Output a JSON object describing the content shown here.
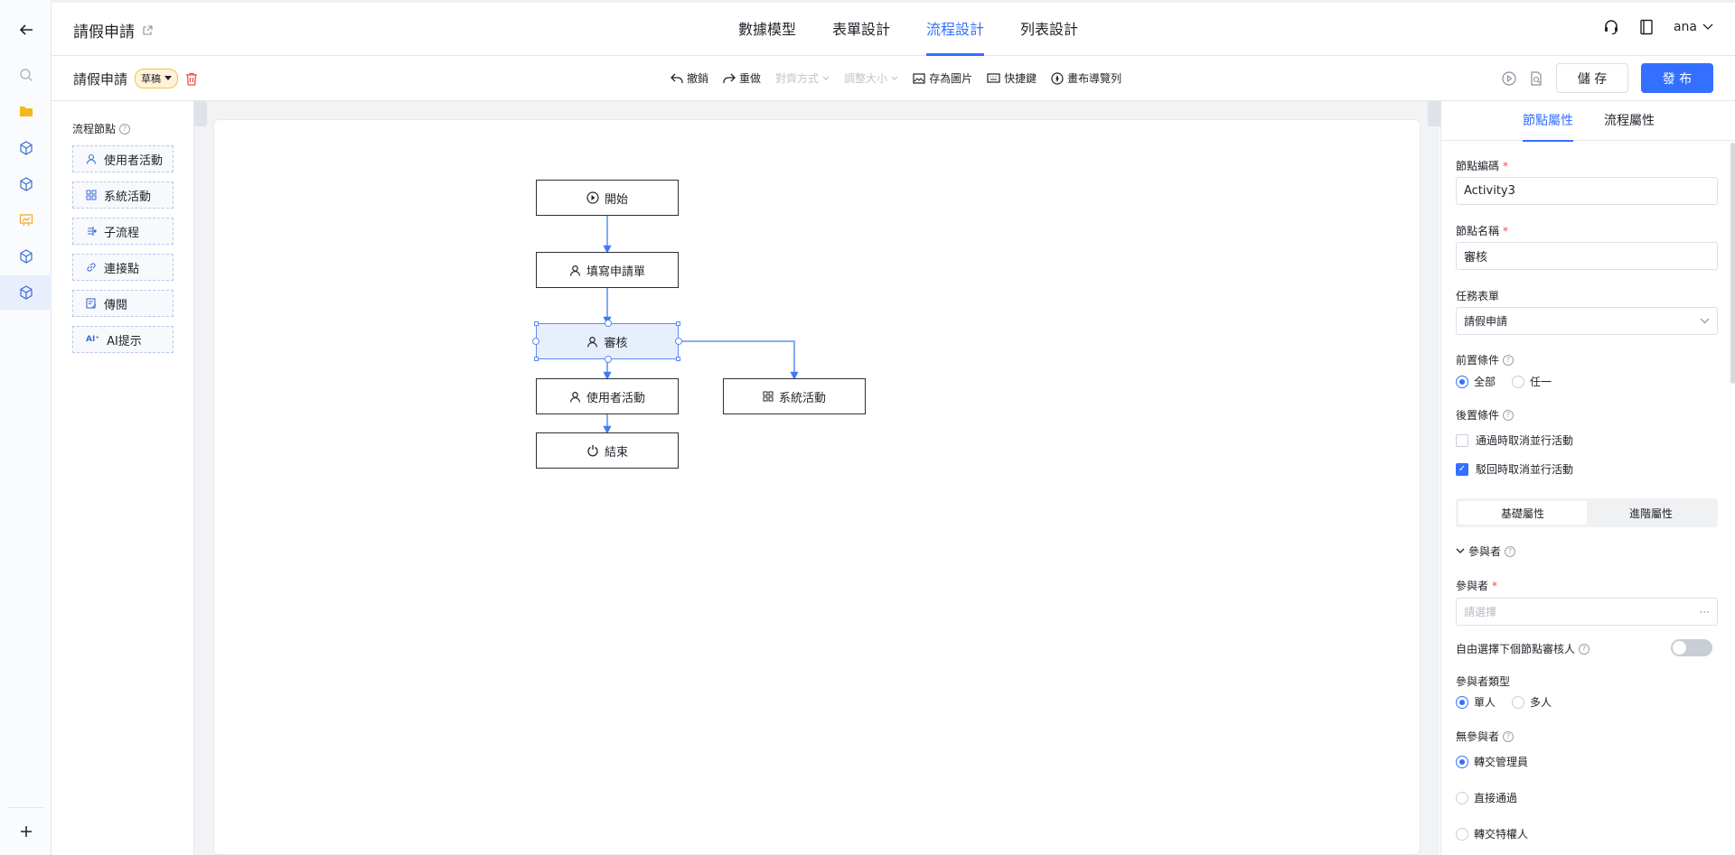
{
  "app": {
    "title": "請假申請"
  },
  "header": {
    "tabs": [
      {
        "label": "數據模型"
      },
      {
        "label": "表單設計"
      },
      {
        "label": "流程設計"
      },
      {
        "label": "列表設計"
      }
    ],
    "active_tab": "流程設計",
    "user": "ana"
  },
  "toolbar": {
    "name": "請假申請",
    "status_badge": "草稿",
    "actions": {
      "undo": "撤銷",
      "redo": "重做",
      "align": "對齊方式",
      "resize": "調整大小",
      "save_image": "存為圖片",
      "shortcuts": "快捷鍵",
      "canvas_nav": "畫布導覽列"
    },
    "save_label": "儲 存",
    "publish_label": "發 布"
  },
  "palette": {
    "title": "流程節點",
    "items": [
      {
        "label": "使用者活動",
        "icon": "user-icon"
      },
      {
        "label": "系統活動",
        "icon": "grid-icon"
      },
      {
        "label": "子流程",
        "icon": "subprocess-icon"
      },
      {
        "label": "連接點",
        "icon": "link-icon"
      },
      {
        "label": "傳閱",
        "icon": "circulate-icon"
      },
      {
        "label": "AI提示",
        "icon": "ai-icon"
      }
    ]
  },
  "flow": {
    "nodes": [
      {
        "label": "開始",
        "icon": "play-icon"
      },
      {
        "label": "填寫申請單",
        "icon": "user-icon"
      },
      {
        "label": "審核",
        "icon": "user-icon",
        "selected": true
      },
      {
        "label": "使用者活動",
        "icon": "user-icon"
      },
      {
        "label": "系統活動",
        "icon": "grid-icon"
      },
      {
        "label": "結束",
        "icon": "power-icon"
      }
    ]
  },
  "props": {
    "tabs": [
      {
        "label": "節點屬性"
      },
      {
        "label": "流程屬性"
      }
    ],
    "node_code": {
      "label": "節點編碼",
      "value": "Activity3"
    },
    "node_name": {
      "label": "節點名稱",
      "value": "審核"
    },
    "task_form": {
      "label": "任務表單",
      "value": "請假申請"
    },
    "pre_condition": {
      "label": "前置條件",
      "options": [
        "全部",
        "任一"
      ],
      "selected": "全部"
    },
    "post_condition": {
      "label": "後置條件",
      "options": [
        {
          "label": "通過時取消並行活動",
          "checked": false
        },
        {
          "label": "駁回時取消並行活動",
          "checked": true
        }
      ]
    },
    "segment": {
      "basic": "基礎屬性",
      "advanced": "進階屬性",
      "selected": "基礎屬性"
    },
    "participants_section": "參與者",
    "participant": {
      "label": "參與者",
      "placeholder": "請選擇",
      "more": "···"
    },
    "free_select": {
      "label": "自由選擇下個節點審核人",
      "on": false
    },
    "participant_type": {
      "label": "參與者類型",
      "options": [
        "單人",
        "多人"
      ],
      "selected": "單人"
    },
    "no_participant": {
      "label": "無參與者",
      "options": [
        "轉交管理員",
        "直接通過",
        "轉交特權人"
      ],
      "selected": "轉交管理員"
    }
  },
  "colors": {
    "accent": "#3370ff",
    "selected_fill": "#e8effc",
    "required": "#f54a45"
  }
}
